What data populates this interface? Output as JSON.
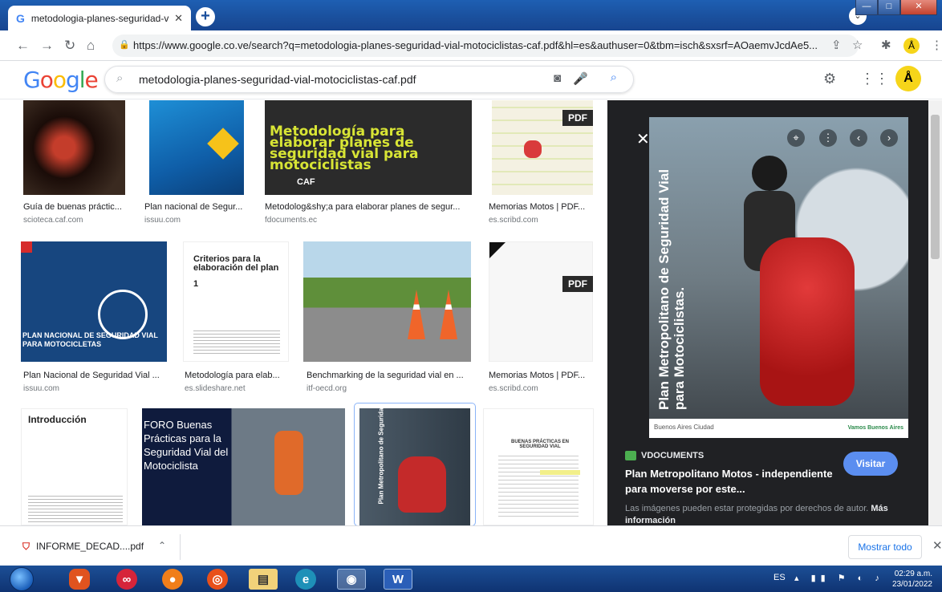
{
  "browser": {
    "tab_title": "metodologia-planes-seguridad-v",
    "tab_icon": "G",
    "url": "https://www.google.co.ve/search?q=metodologia-planes-seguridad-vial-motociclistas-caf.pdf&hl=es&authuser=0&tbm=isch&sxsrf=AOaemvJcdAe5..."
  },
  "google": {
    "logo": [
      "G",
      "o",
      "o",
      "g",
      "l",
      "e"
    ],
    "logo_colors": [
      "#4285f4",
      "#ea4335",
      "#fbbc05",
      "#4285f4",
      "#34a853",
      "#ea4335"
    ],
    "query": "metodologia-planes-seguridad-vial-motociclistas-caf.pdf"
  },
  "results": [
    {
      "caption": "Guía de buenas práctic...",
      "source": "scioteca.caf.com",
      "pdf": false
    },
    {
      "caption": "Plan nacional de Segur...",
      "source": "issuu.com",
      "pdf": false
    },
    {
      "caption": "Metodolog&shy;a para elaborar planes de segur...",
      "source": "fdocuments.ec",
      "pdf": false,
      "thumb_text": "Metodología para elaborar planes de seguridad vial para motociclistas",
      "thumb_logo": "CAF"
    },
    {
      "caption": "Memorias Motos | PDF...",
      "source": "es.scribd.com",
      "pdf": true
    },
    {
      "caption": "Plan Nacional de Seguridad Vial ...",
      "source": "issuu.com",
      "pdf": false,
      "thumb_text": "PLAN NACIONAL DE SEGURIDAD VIAL PARA MOTOCICLETAS"
    },
    {
      "caption": "Metodología para elab...",
      "source": "es.slideshare.net",
      "pdf": false,
      "thumb_text": "Criterios para la elaboración del plan",
      "thumb_num": "1"
    },
    {
      "caption": "Benchmarking de la seguridad vial en ...",
      "source": "itf-oecd.org",
      "pdf": false
    },
    {
      "caption": "Memorias Motos | PDF...",
      "source": "es.scribd.com",
      "pdf": true
    },
    {
      "thumb_text": "Introducción"
    },
    {
      "thumb_text": "FORO Buenas Prácticas para la Seguridad Vial del Motociclista"
    },
    {
      "thumb_text": "Plan Metropolitano de Seguridad Vial para Motociclistas"
    },
    {
      "thumb_text": "BUENAS PRÁCTICAS EN SEGURIDAD VIAL"
    }
  ],
  "pdf_label": "PDF",
  "preview": {
    "source_name": "VDOCUMENTS",
    "title": "Plan Metropolitano Motos - independiente para moverse por este...",
    "visit_label": "Visitar",
    "notice": "Las imágenes pueden estar protegidas por derechos de autor.",
    "notice_link": "Más información",
    "image_text": "Plan Metropolitano de Seguridad Vial para Motociclistas.",
    "footer_left": "Buenos Aires Ciudad",
    "footer_right": "Vamos Buenos Aires"
  },
  "downloads": {
    "file": "INFORME_DECAD....pdf",
    "show_all": "Mostrar todo"
  },
  "taskbar": {
    "lang": "ES",
    "time": "02:29 a.m.",
    "date": "23/01/2022"
  }
}
